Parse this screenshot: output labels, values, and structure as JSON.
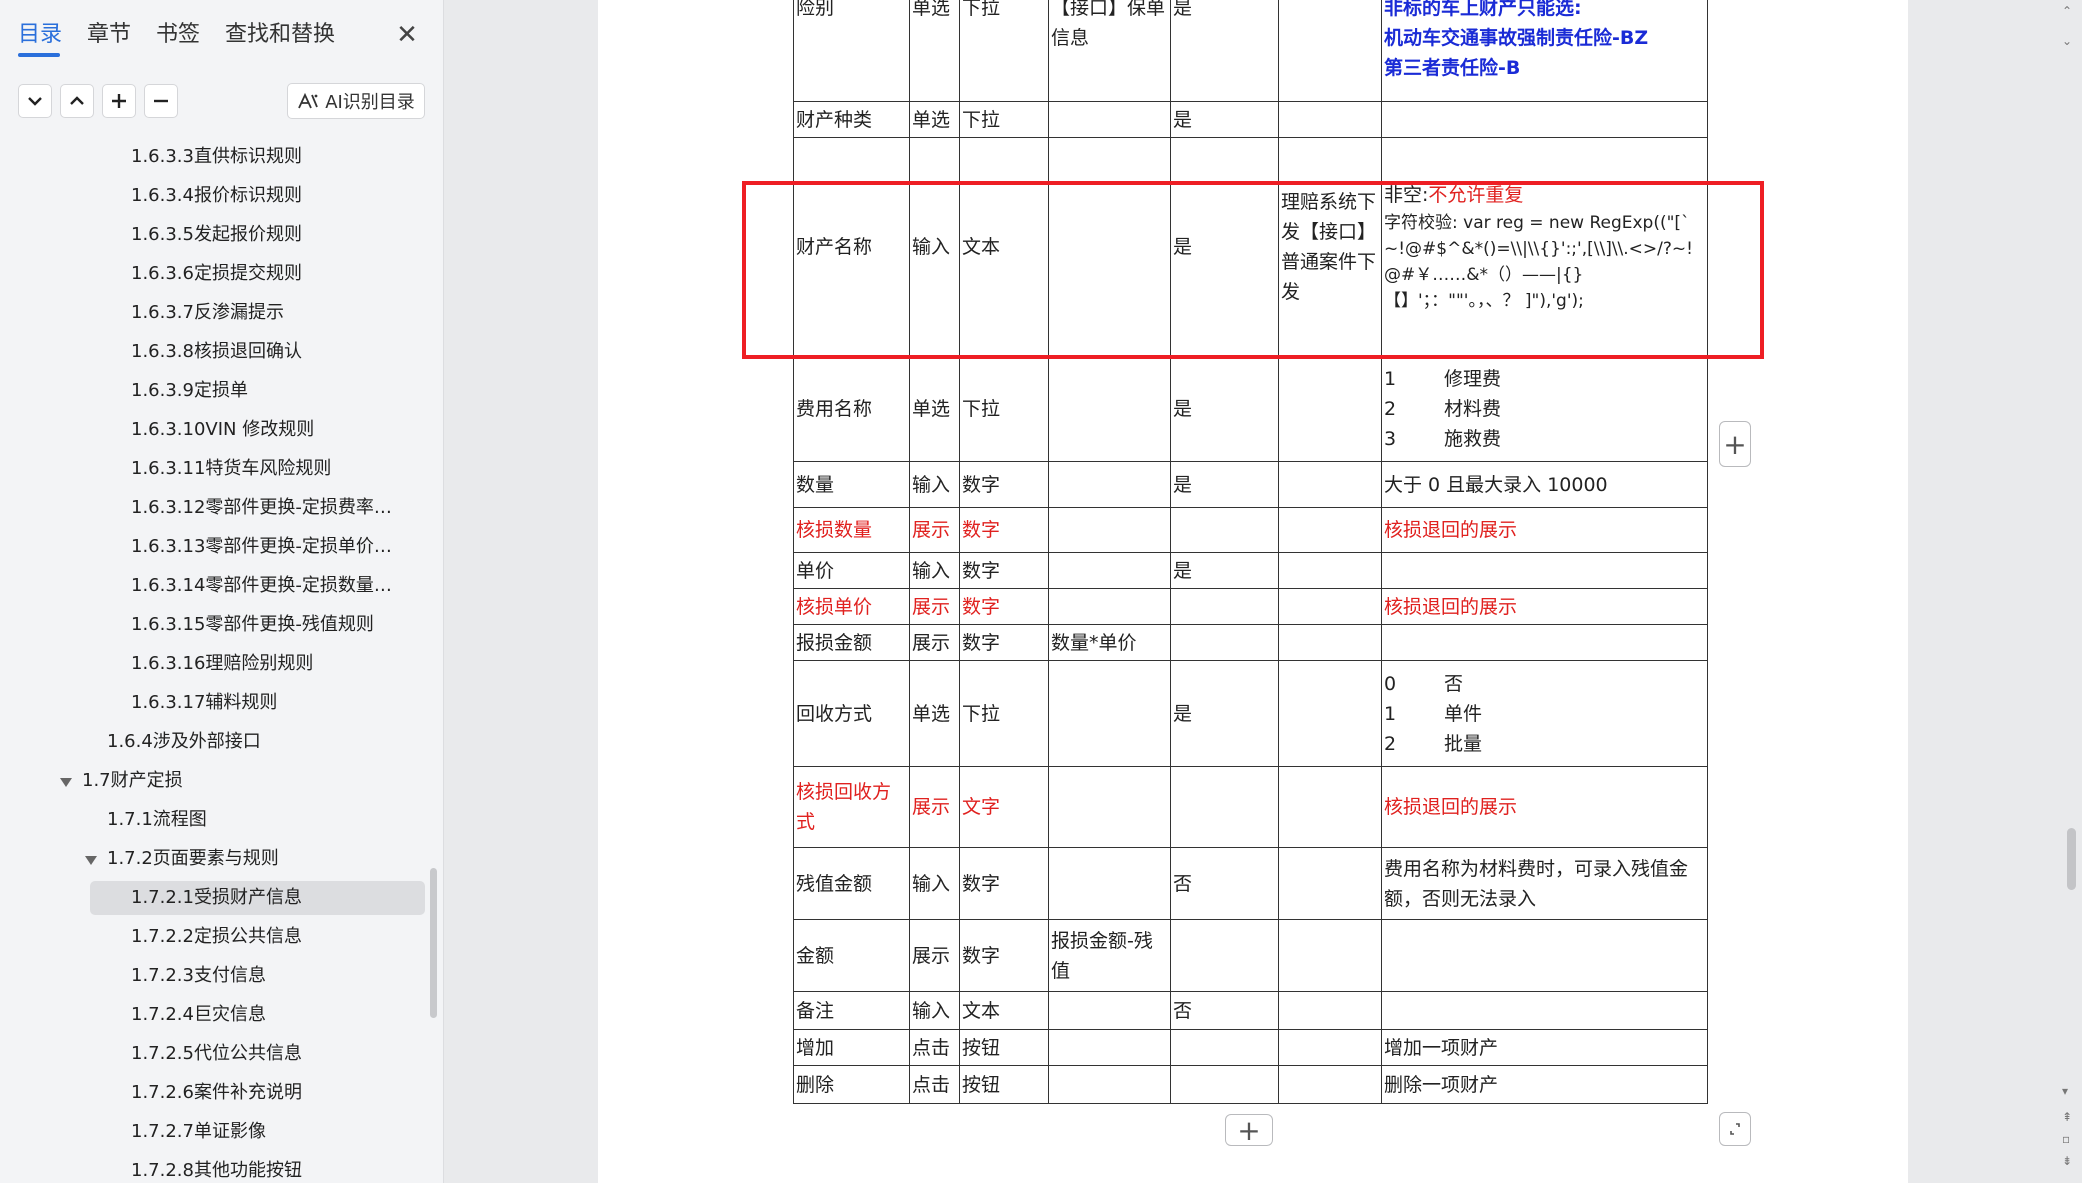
{
  "sidebar": {
    "tabs": [
      "目录",
      "章节",
      "书签",
      "查找和替换"
    ],
    "close_glyph": "✕",
    "toolbar": {
      "icons": [
        "chevron-down-icon",
        "chevron-up-icon",
        "plus-icon",
        "minus-icon"
      ],
      "ai_label": "AI识别目录"
    },
    "toc": [
      "1.6.3.3直供标识规则",
      "1.6.3.4报价标识规则",
      "1.6.3.5发起报价规则",
      "1.6.3.6定损提交规则",
      "1.6.3.7反渗漏提示",
      "1.6.3.8核损退回确认",
      "1.6.3.9定损单",
      "1.6.3.10VIN 修改规则",
      "1.6.3.11特货车风险规则",
      "1.6.3.12零部件更换-定损费率规...",
      "1.6.3.13零部件更换-定损单价规...",
      "1.6.3.14零部件更换-定损数量规...",
      "1.6.3.15零部件更换-残值规则",
      "1.6.3.16理赔险别规则",
      "1.6.3.17辅料规则",
      "1.6.4涉及外部接口",
      "1.7财产定损",
      "1.7.1流程图",
      "1.7.2页面要素与规则",
      "1.7.2.1受损财产信息",
      "1.7.2.2定损公共信息",
      "1.7.2.3支付信息",
      "1.7.2.4巨灾信息",
      "1.7.2.5代位公共信息",
      "1.7.2.6案件补充说明",
      "1.7.2.7单证影像",
      "1.7.2.8其他功能按钮"
    ],
    "selected_item": "1.7.2.1受损财产信息"
  },
  "document": {
    "table": {
      "rows": [
        {
          "c1": "险别",
          "c2": "单选",
          "c3": "下拉",
          "c4": "【接口】保单信息",
          "c5": "是",
          "c6": "",
          "rule_lines": [
            "非标的车上财产只能选:",
            "机动车交通事故强制责任险-BZ",
            "第三者责任险-B"
          ]
        },
        {
          "c1": "财产种类",
          "c2": "单选",
          "c3": "下拉",
          "c4": "",
          "c5": "是",
          "c6": "",
          "rule": ""
        },
        {
          "c1": "财产名称",
          "c2": "输入",
          "c3": "文本",
          "c4": "",
          "c5": "是",
          "c6": "理赔系统下发【接口】普通案件下发",
          "rule_prefix": "非空:",
          "rule_red": "不允许重复",
          "rule_rest": "字符校验: var reg = new RegExp((\"[`~!@#$^&*()=\\\\|\\\\{}':;',[\\\\]\\\\.<>/?~! @#￥……&*（）——|{}【】'；：\"\"'。，、？ ]\"),'g');"
        },
        {
          "c1": "费用名称",
          "c2": "单选",
          "c3": "下拉",
          "c4": "",
          "c5": "是",
          "c6": "",
          "options": [
            [
              "1",
              "修理费"
            ],
            [
              "2",
              "材料费"
            ],
            [
              "3",
              "施救费"
            ]
          ]
        },
        {
          "c1": "数量",
          "c2": "输入",
          "c3": "数字",
          "c4": "",
          "c5": "是",
          "c6": "",
          "rule": "大于 0 且最大录入 10000"
        },
        {
          "c1": "核损数量",
          "c2": "展示",
          "c3": "数字",
          "c4": "",
          "c5": "",
          "c6": "",
          "rule": "核损退回的展示",
          "red": true
        },
        {
          "c1": "单价",
          "c2": "输入",
          "c3": "数字",
          "c4": "",
          "c5": "是",
          "c6": "",
          "rule": ""
        },
        {
          "c1": "核损单价",
          "c2": "展示",
          "c3": "数字",
          "c4": "",
          "c5": "",
          "c6": "",
          "rule": "核损退回的展示",
          "red": true
        },
        {
          "c1": "报损金额",
          "c2": "展示",
          "c3": "数字",
          "c4": "数量*单价",
          "c5": "",
          "c6": "",
          "rule": ""
        },
        {
          "c1": "回收方式",
          "c2": "单选",
          "c3": "下拉",
          "c4": "",
          "c5": "是",
          "c6": "",
          "options": [
            [
              "0",
              "否"
            ],
            [
              "1",
              "单件"
            ],
            [
              "2",
              "批量"
            ]
          ]
        },
        {
          "c1": "核损回收方式",
          "c2": "展示",
          "c3": "文字",
          "c4": "",
          "c5": "",
          "c6": "",
          "rule": "核损退回的展示",
          "red": true
        },
        {
          "c1": "残值金额",
          "c2": "输入",
          "c3": "数字",
          "c4": "",
          "c5": "否",
          "c6": "",
          "rule": "费用名称为材料费时，可录入残值金额，否则无法录入"
        },
        {
          "c1": "金额",
          "c2": "展示",
          "c3": "数字",
          "c4": "报损金额-残值",
          "c5": "",
          "c6": "",
          "rule": ""
        },
        {
          "c1": "备注",
          "c2": "输入",
          "c3": "文本",
          "c4": "",
          "c5": "否",
          "c6": "",
          "rule": ""
        },
        {
          "c1": "增加",
          "c2": "点击",
          "c3": "按钮",
          "c4": "",
          "c5": "",
          "c6": "",
          "rule": "增加一项财产"
        },
        {
          "c1": "删除",
          "c2": "点击",
          "c3": "按钮",
          "c4": "",
          "c5": "",
          "c6": "",
          "rule": "删除一项财产"
        }
      ]
    },
    "add_glyph": "+",
    "colors": {
      "highlight": "#ee1e24",
      "red_text": "#e0211f",
      "blue_text": "#1a2bd6",
      "accent": "#2a6fdb"
    }
  }
}
